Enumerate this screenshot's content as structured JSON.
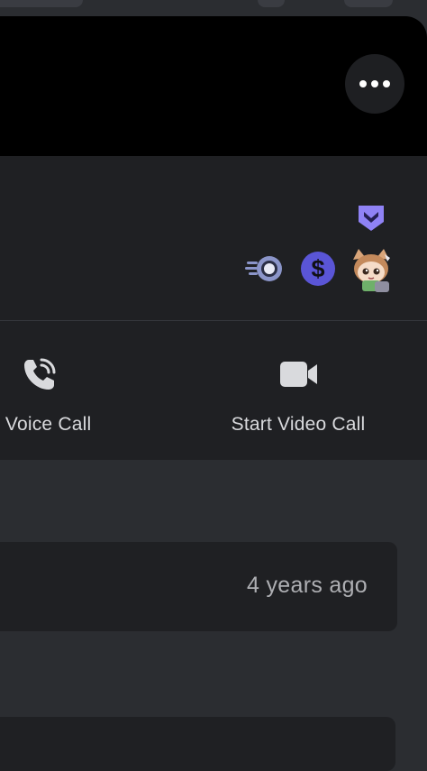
{
  "header": {
    "more_icon": "more-horizontal-icon"
  },
  "profile": {
    "badges": [
      {
        "name": "nitro-icon",
        "color": "#8f82f5"
      },
      {
        "name": "speed-badge-icon",
        "color": "#8b95c9"
      },
      {
        "name": "dollar-badge-icon",
        "color": "#5a55d6",
        "glyph": "$"
      },
      {
        "name": "avatar-badge-icon"
      }
    ]
  },
  "actions": {
    "voice_label": "rt Voice Call",
    "video_label": "Start Video Call"
  },
  "member_since": {
    "text": "4 years ago"
  },
  "colors": {
    "background": "#2b2d31",
    "banner": "#000000",
    "card": "#1f2023",
    "text_primary": "#d9dadd",
    "text_secondary": "#aeafb3",
    "accent": "#5a55d6"
  }
}
